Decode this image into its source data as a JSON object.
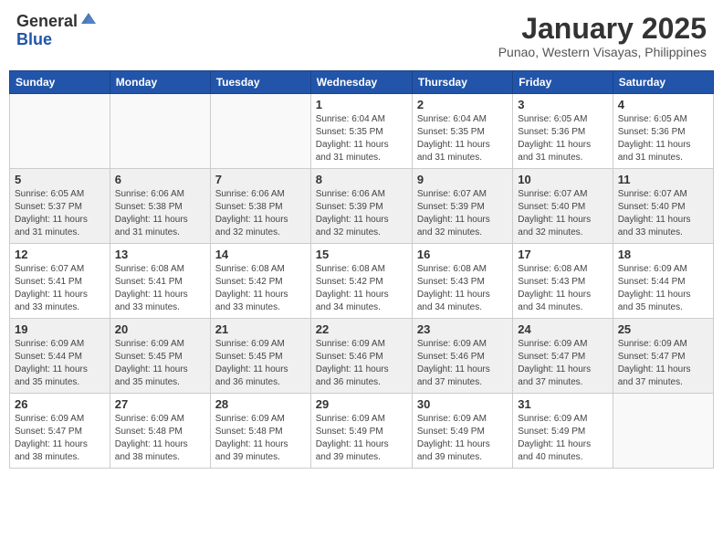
{
  "header": {
    "logo_general": "General",
    "logo_blue": "Blue",
    "month_title": "January 2025",
    "location": "Punao, Western Visayas, Philippines"
  },
  "days_of_week": [
    "Sunday",
    "Monday",
    "Tuesday",
    "Wednesday",
    "Thursday",
    "Friday",
    "Saturday"
  ],
  "weeks": [
    [
      {
        "day": "",
        "info": ""
      },
      {
        "day": "",
        "info": ""
      },
      {
        "day": "",
        "info": ""
      },
      {
        "day": "1",
        "info": "Sunrise: 6:04 AM\nSunset: 5:35 PM\nDaylight: 11 hours\nand 31 minutes."
      },
      {
        "day": "2",
        "info": "Sunrise: 6:04 AM\nSunset: 5:35 PM\nDaylight: 11 hours\nand 31 minutes."
      },
      {
        "day": "3",
        "info": "Sunrise: 6:05 AM\nSunset: 5:36 PM\nDaylight: 11 hours\nand 31 minutes."
      },
      {
        "day": "4",
        "info": "Sunrise: 6:05 AM\nSunset: 5:36 PM\nDaylight: 11 hours\nand 31 minutes."
      }
    ],
    [
      {
        "day": "5",
        "info": "Sunrise: 6:05 AM\nSunset: 5:37 PM\nDaylight: 11 hours\nand 31 minutes."
      },
      {
        "day": "6",
        "info": "Sunrise: 6:06 AM\nSunset: 5:38 PM\nDaylight: 11 hours\nand 31 minutes."
      },
      {
        "day": "7",
        "info": "Sunrise: 6:06 AM\nSunset: 5:38 PM\nDaylight: 11 hours\nand 32 minutes."
      },
      {
        "day": "8",
        "info": "Sunrise: 6:06 AM\nSunset: 5:39 PM\nDaylight: 11 hours\nand 32 minutes."
      },
      {
        "day": "9",
        "info": "Sunrise: 6:07 AM\nSunset: 5:39 PM\nDaylight: 11 hours\nand 32 minutes."
      },
      {
        "day": "10",
        "info": "Sunrise: 6:07 AM\nSunset: 5:40 PM\nDaylight: 11 hours\nand 32 minutes."
      },
      {
        "day": "11",
        "info": "Sunrise: 6:07 AM\nSunset: 5:40 PM\nDaylight: 11 hours\nand 33 minutes."
      }
    ],
    [
      {
        "day": "12",
        "info": "Sunrise: 6:07 AM\nSunset: 5:41 PM\nDaylight: 11 hours\nand 33 minutes."
      },
      {
        "day": "13",
        "info": "Sunrise: 6:08 AM\nSunset: 5:41 PM\nDaylight: 11 hours\nand 33 minutes."
      },
      {
        "day": "14",
        "info": "Sunrise: 6:08 AM\nSunset: 5:42 PM\nDaylight: 11 hours\nand 33 minutes."
      },
      {
        "day": "15",
        "info": "Sunrise: 6:08 AM\nSunset: 5:42 PM\nDaylight: 11 hours\nand 34 minutes."
      },
      {
        "day": "16",
        "info": "Sunrise: 6:08 AM\nSunset: 5:43 PM\nDaylight: 11 hours\nand 34 minutes."
      },
      {
        "day": "17",
        "info": "Sunrise: 6:08 AM\nSunset: 5:43 PM\nDaylight: 11 hours\nand 34 minutes."
      },
      {
        "day": "18",
        "info": "Sunrise: 6:09 AM\nSunset: 5:44 PM\nDaylight: 11 hours\nand 35 minutes."
      }
    ],
    [
      {
        "day": "19",
        "info": "Sunrise: 6:09 AM\nSunset: 5:44 PM\nDaylight: 11 hours\nand 35 minutes."
      },
      {
        "day": "20",
        "info": "Sunrise: 6:09 AM\nSunset: 5:45 PM\nDaylight: 11 hours\nand 35 minutes."
      },
      {
        "day": "21",
        "info": "Sunrise: 6:09 AM\nSunset: 5:45 PM\nDaylight: 11 hours\nand 36 minutes."
      },
      {
        "day": "22",
        "info": "Sunrise: 6:09 AM\nSunset: 5:46 PM\nDaylight: 11 hours\nand 36 minutes."
      },
      {
        "day": "23",
        "info": "Sunrise: 6:09 AM\nSunset: 5:46 PM\nDaylight: 11 hours\nand 37 minutes."
      },
      {
        "day": "24",
        "info": "Sunrise: 6:09 AM\nSunset: 5:47 PM\nDaylight: 11 hours\nand 37 minutes."
      },
      {
        "day": "25",
        "info": "Sunrise: 6:09 AM\nSunset: 5:47 PM\nDaylight: 11 hours\nand 37 minutes."
      }
    ],
    [
      {
        "day": "26",
        "info": "Sunrise: 6:09 AM\nSunset: 5:47 PM\nDaylight: 11 hours\nand 38 minutes."
      },
      {
        "day": "27",
        "info": "Sunrise: 6:09 AM\nSunset: 5:48 PM\nDaylight: 11 hours\nand 38 minutes."
      },
      {
        "day": "28",
        "info": "Sunrise: 6:09 AM\nSunset: 5:48 PM\nDaylight: 11 hours\nand 39 minutes."
      },
      {
        "day": "29",
        "info": "Sunrise: 6:09 AM\nSunset: 5:49 PM\nDaylight: 11 hours\nand 39 minutes."
      },
      {
        "day": "30",
        "info": "Sunrise: 6:09 AM\nSunset: 5:49 PM\nDaylight: 11 hours\nand 39 minutes."
      },
      {
        "day": "31",
        "info": "Sunrise: 6:09 AM\nSunset: 5:49 PM\nDaylight: 11 hours\nand 40 minutes."
      },
      {
        "day": "",
        "info": ""
      }
    ]
  ]
}
